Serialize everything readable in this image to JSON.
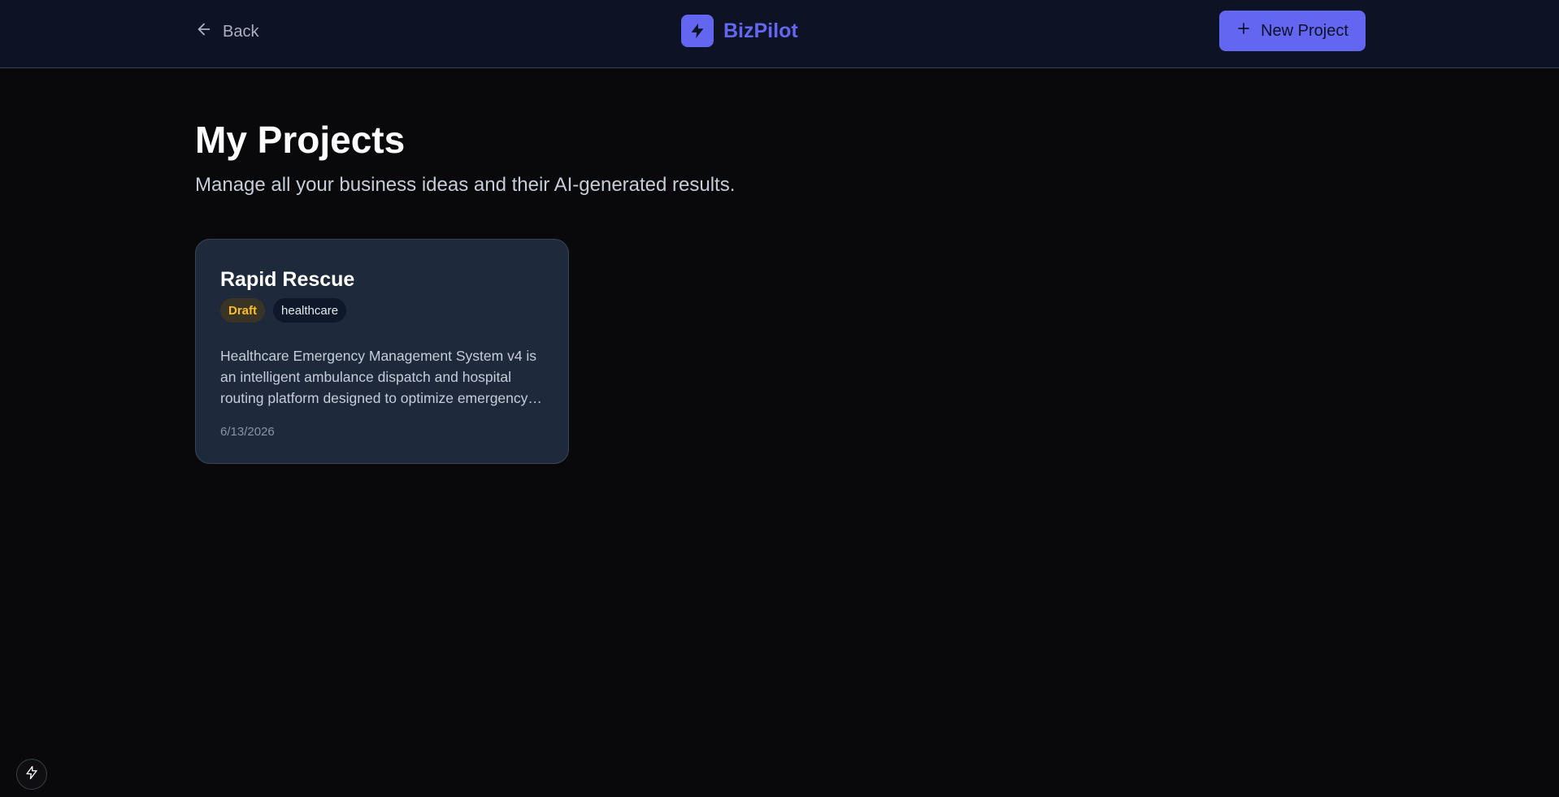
{
  "header": {
    "back_label": "Back",
    "brand_name": "BizPilot",
    "new_project_label": "New Project",
    "back_icon": "arrow-left-icon",
    "brand_icon": "lightning-bolt-icon",
    "new_project_icon": "plus-icon"
  },
  "main": {
    "title": "My Projects",
    "subtitle": "Manage all your business ideas and their AI-generated results."
  },
  "projects": [
    {
      "title": "Rapid Rescue",
      "status": "Draft",
      "category": "healthcare",
      "description": "Healthcare Emergency Management System v4 is an intelligent ambulance dispatch and hospital routing platform designed to optimize emergency response",
      "date": "6/13/2026"
    }
  ],
  "floating": {
    "icon": "lightning-bolt-outline-icon"
  },
  "colors": {
    "accent": "#6366f1",
    "background": "#09090b",
    "header_bg": "#0d1324",
    "card_bg": "#1e293b",
    "draft_text": "#fbbf24"
  }
}
